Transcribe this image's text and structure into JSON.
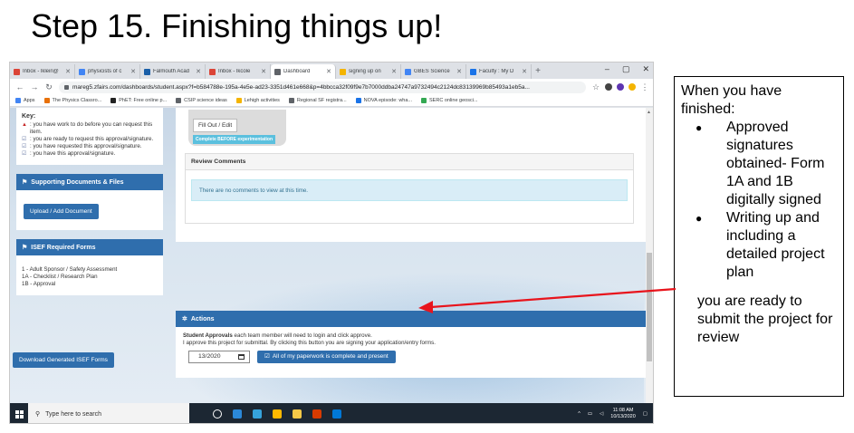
{
  "slide": {
    "title": "Step 15. Finishing things up!"
  },
  "browser": {
    "tabs": [
      {
        "label": "Inbox - lklein@",
        "color": "#db4437",
        "active": false
      },
      {
        "label": "physicists of c",
        "color": "#4285f4",
        "active": false
      },
      {
        "label": "Falmouth Acad",
        "color": "#1a5fa8",
        "active": false
      },
      {
        "label": "Inbox - lkcole",
        "color": "#db4437",
        "active": false
      },
      {
        "label": "Dashboard",
        "color": "#5f6368",
        "active": true
      },
      {
        "label": "signing up on",
        "color": "#f4b400",
        "active": false
      },
      {
        "label": "GBES Science",
        "color": "#4285f4",
        "active": false
      },
      {
        "label": "Faculty : My D",
        "color": "#1a73e8",
        "active": false
      }
    ],
    "new_tab": "+",
    "window_controls": [
      "–",
      "▢",
      "✕"
    ],
    "url": "mareg5.zfairs.com/dashboards/student.aspx?f=b584788e-195a-4e5e-ad23-3351d461e668&p=4bbcca32f09f9e7b7000ddba24747a9732494c2124dc83139969b85493a1eb5a...",
    "bookmarks": [
      {
        "label": "Apps",
        "color": "#4285f4"
      },
      {
        "label": "The Physics Classro...",
        "color": "#e8710a"
      },
      {
        "label": "PhET: Free online p...",
        "color": "#222222"
      },
      {
        "label": "CSIP science ideas",
        "color": "#5f6368"
      },
      {
        "label": "Lehigh activities",
        "color": "#f4b400"
      },
      {
        "label": "Regional SF registra...",
        "color": "#5f6368"
      },
      {
        "label": "NOVA episode: wha...",
        "color": "#1a73e8"
      },
      {
        "label": "SERC online geosci...",
        "color": "#34a853"
      }
    ]
  },
  "dashboard": {
    "key": {
      "title": "Key:",
      "items": [
        {
          "icon": "▲",
          "text": ": you have work to do before you can request this item."
        },
        {
          "icon": "☑",
          "text": ": you are ready to request this approval/signature."
        },
        {
          "icon": "☑",
          "text": ": you have requested this approval/signature."
        },
        {
          "icon": "☑",
          "text": ": you have this approval/signature."
        }
      ]
    },
    "supporting_docs": {
      "title": "Supporting Documents & Files",
      "button": "Upload / Add Document"
    },
    "isef_forms": {
      "title": "ISEF Required Forms",
      "items": [
        "1 - Adult Sponsor / Safety Assessment",
        "1A - Checklist / Research Plan",
        "1B - Approval"
      ]
    },
    "download_button": "Download Generated ISEF Forms",
    "fill_out": {
      "button": "Fill Out / Edit",
      "badge": "Complete BEFORE experimentation"
    },
    "review": {
      "title": "Review Comments",
      "empty_text": "There are no comments to view at this time."
    },
    "actions": {
      "title": "Actions",
      "label_bold": "Student Approvals",
      "label_rest": " each team member will need to login and click approve.",
      "line2": "I approve this project for submittal. By clicking this button you are signing your application/entry forms.",
      "date": "13/2020",
      "complete_button": "All of my paperwork is complete and present"
    }
  },
  "taskbar": {
    "search_placeholder": "Type here to search",
    "time": "11:08 AM",
    "date": "10/13/2020",
    "icon_colors": [
      "#ffffff",
      "#2b88d8",
      "#36a3dc",
      "#ffb900",
      "#f7c948",
      "#d83b01",
      "#0078d7"
    ]
  },
  "callout": {
    "intro": "When you have finished:",
    "bullets": [
      "Approved signatures obtained- Form 1A and 1B digitally signed",
      "Writing up and including a detailed project plan"
    ],
    "outro": "you are ready to submit the project for review"
  }
}
